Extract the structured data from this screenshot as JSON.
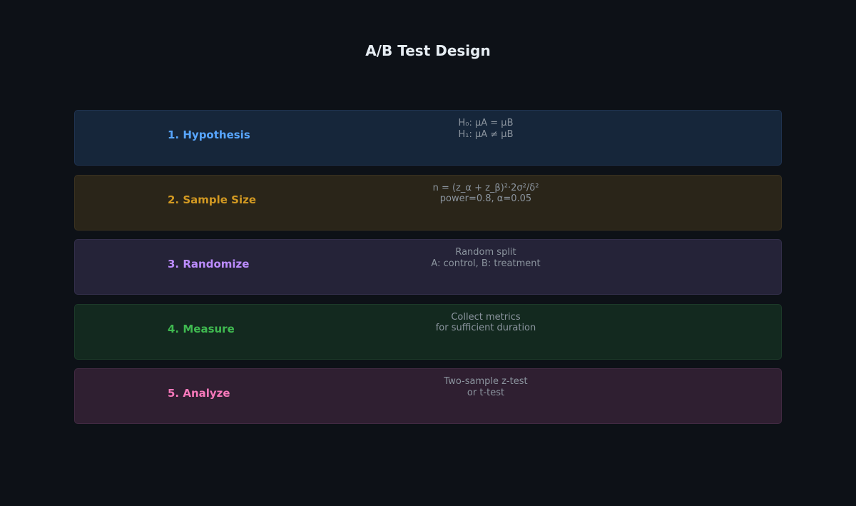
{
  "title": "A/B Test Design",
  "steps": [
    {
      "label": "1. Hypothesis",
      "lines": [
        "H₀: μA = μB",
        "H₁: μA ≠ μB"
      ],
      "label_color": "#58a6ff",
      "bg_color": "#16263a",
      "border_color": "#1f3350"
    },
    {
      "label": "2. Sample Size",
      "lines": [
        "n = (z_α + z_β)²·2σ²/δ²",
        "power=0.8, α=0.05"
      ],
      "label_color": "#d29922",
      "bg_color": "#2a2519",
      "border_color": "#3a3220"
    },
    {
      "label": "3. Randomize",
      "lines": [
        "Random split",
        "A: control, B: treatment"
      ],
      "label_color": "#bc8cff",
      "bg_color": "#252338",
      "border_color": "#332f4a"
    },
    {
      "label": "4. Measure",
      "lines": [
        "Collect metrics",
        "for sufficient duration"
      ],
      "label_color": "#3fb950",
      "bg_color": "#13291f",
      "border_color": "#1c3a29"
    },
    {
      "label": "5. Analyze",
      "lines": [
        "Two-sample z-test",
        "or t-test"
      ],
      "label_color": "#f778ba",
      "bg_color": "#2f1f31",
      "border_color": "#412a42"
    }
  ]
}
